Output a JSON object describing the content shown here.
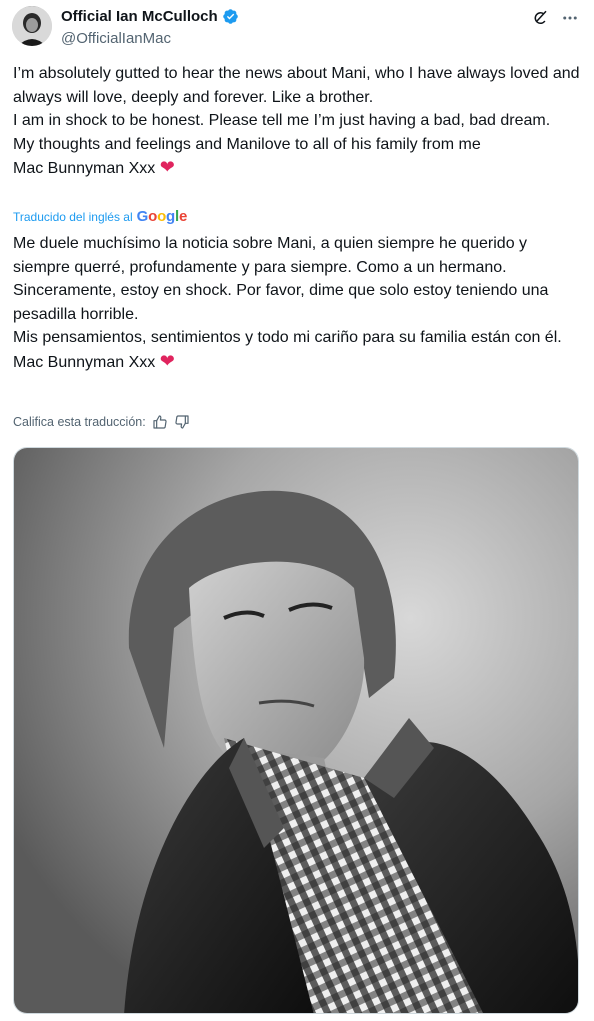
{
  "author": {
    "name": "Official Ian McCulloch",
    "handle": "@OfficialIanMac"
  },
  "icons": {
    "verified": "verified-badge-icon",
    "grok": "grok-icon",
    "more": "more-options-icon",
    "thumbs_up": "thumbs-up-icon",
    "thumbs_down": "thumbs-down-icon"
  },
  "colors": {
    "accent": "#1d9bf0",
    "heart": "#e0245e",
    "text": "#0f1419",
    "secondary": "#536471"
  },
  "tweet": {
    "lines": [
      "I’m absolutely gutted to hear the news about Mani, who I have always loved and always will love, deeply and forever. Like a brother.",
      "I am in shock to be honest. Please tell me I’m just having a bad, bad dream.",
      "My thoughts and feelings and Manilove to all of his family from me"
    ],
    "signature": "Mac Bunnyman Xxx"
  },
  "translation": {
    "label": "Traducido del inglés al",
    "provider": "Google",
    "lines": [
      "Me duele muchísimo la noticia sobre Mani, a quien siempre he querido y siempre querré, profundamente y para siempre. Como a un hermano.",
      "Sinceramente, estoy en shock. Por favor, dime que solo estoy teniendo una pesadilla horrible.",
      "Mis pensamientos, sentimientos y todo mi cariño para su familia están con él."
    ],
    "signature": "Mac Bunnyman Xxx",
    "rate_label": "Califica esta traducción:"
  }
}
